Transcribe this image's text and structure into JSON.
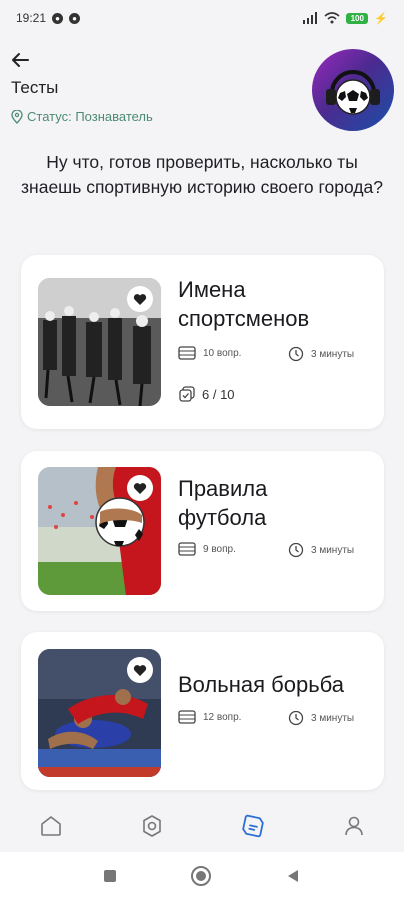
{
  "status_bar": {
    "time": "19:21",
    "battery": "100"
  },
  "header": {
    "title": "Тесты",
    "status_text": "Статус: Познаватель"
  },
  "intro_text": "Ну что, готов проверить, насколько ты знаешь спортивную историю своего города?",
  "quizzes": [
    {
      "title_line1": "Имена",
      "title_line2": "спортсменов",
      "questions": "10 вопр.",
      "duration": "3 минуты",
      "progress": "6 / 10"
    },
    {
      "title_line1": "Правила",
      "title_line2": "футбола",
      "questions": "9 вопр.",
      "duration": "3 минуты"
    },
    {
      "title_line1": "Вольная борьба",
      "questions": "12 вопр.",
      "duration": "3 минуты"
    }
  ],
  "colors": {
    "accent": "#2c6fd6",
    "status_green": "#4d8a72",
    "background": "#f4f4f6"
  },
  "bottom_nav": [
    "home-icon",
    "badge-icon",
    "quiz-icon",
    "profile-icon"
  ]
}
